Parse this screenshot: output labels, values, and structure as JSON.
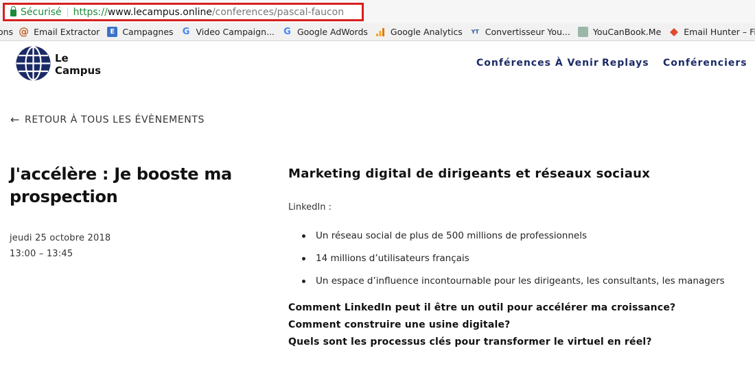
{
  "browser": {
    "secure_label": "Sécurisé",
    "url_scheme": "https://",
    "url_host": "www.lecampus.online",
    "url_path": "/conferences/pascal-faucon"
  },
  "bookmarks": [
    {
      "label": "ons",
      "icon": "none"
    },
    {
      "label": "Email Extractor",
      "icon": "at-icon"
    },
    {
      "label": "Campagnes",
      "icon": "campaign-icon"
    },
    {
      "label": "Video Campaign...",
      "icon": "google-icon"
    },
    {
      "label": "Google AdWords",
      "icon": "google-icon"
    },
    {
      "label": "Google Analytics",
      "icon": "analytics-icon"
    },
    {
      "label": "Convertisseur You...",
      "icon": "youtube-mp3-icon"
    },
    {
      "label": "YouCanBook.Me",
      "icon": "calendar-icon"
    },
    {
      "label": "Email Hunter – Fi...",
      "icon": "hunter-icon"
    }
  ],
  "site": {
    "logo_line1": "Le",
    "logo_line2": "Campus",
    "brand_color": "#1b2a66",
    "nav": [
      "Conférences À Venir",
      "Replays",
      "Conférenciers"
    ]
  },
  "event": {
    "back_label": "RETOUR À TOUS LES ÉVÈNEMENTS",
    "title": "J'accélère : Je booste ma prospection",
    "date": "jeudi 25 octobre 2018",
    "time": "13:00 – 13:45",
    "heading": "Marketing digital de dirigeants et réseaux sociaux",
    "intro": "LinkedIn :",
    "bullets": [
      "Un réseau social de plus de 500 millions de professionnels",
      "14 millions d’utilisateurs français",
      "Un espace d’influence incontournable pour les dirigeants, les consultants, les managers"
    ],
    "questions": [
      "Comment LinkedIn peut il être un outil pour accélérer ma croissance?",
      "Comment construire une usine digitale?",
      "Quels sont les processus clés pour transformer le virtuel en réel?"
    ]
  }
}
